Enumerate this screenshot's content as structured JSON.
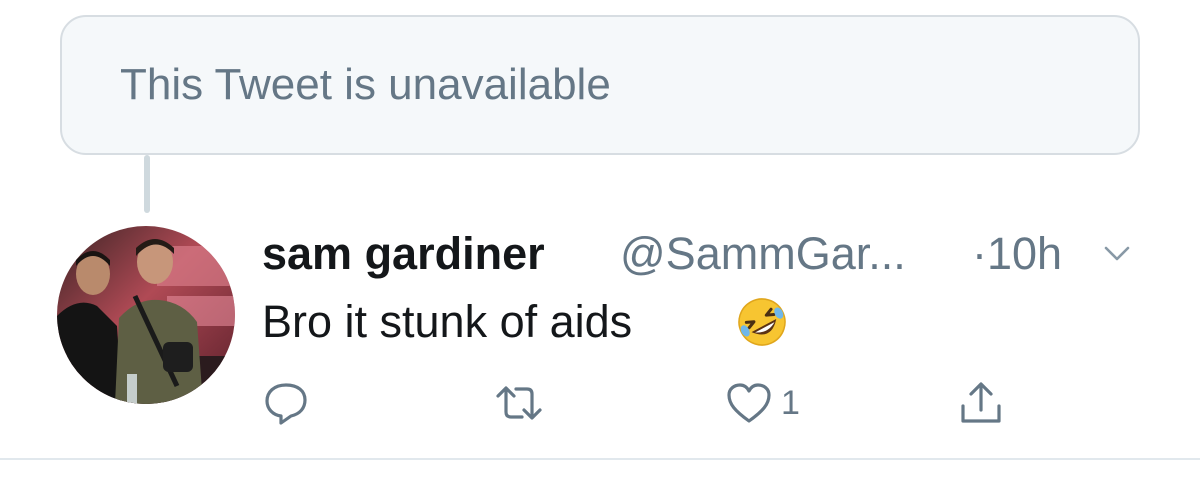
{
  "unavailable_notice": {
    "text": "This Tweet is unavailable"
  },
  "tweet": {
    "display_name": "sam gardiner",
    "handle": "@SammGar...",
    "timestamp": "·10h",
    "text": "Bro it stunk of aids",
    "emoji": "rolling-on-the-floor-laughing",
    "like_count": "1"
  },
  "icons": {
    "reply": "reply-icon",
    "retweet": "retweet-icon",
    "like": "heart-icon",
    "share": "share-icon",
    "caret": "chevron-down-icon"
  },
  "colors": {
    "secondary_text": "#657786",
    "primary_text": "#14171a",
    "notice_background": "#f5f8fa",
    "notice_border": "#d7dde2"
  }
}
